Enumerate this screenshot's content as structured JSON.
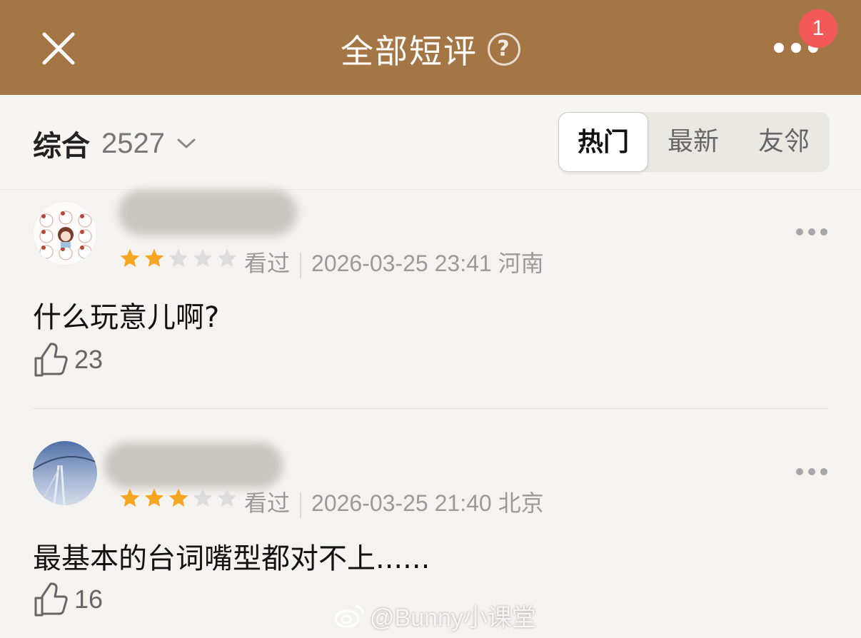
{
  "header": {
    "title": "全部短评",
    "help_icon": "question-circle-icon",
    "close_icon": "close-icon",
    "more_icon": "more-dots-icon",
    "badge_count": "1",
    "background_color": "#a57645"
  },
  "filter": {
    "sort_label": "综合",
    "count": "2527",
    "tabs": [
      {
        "label": "热门",
        "active": true
      },
      {
        "label": "最新",
        "active": false
      },
      {
        "label": "友邻",
        "active": false
      }
    ]
  },
  "comments": [
    {
      "rating": 2,
      "rating_max": 5,
      "status": "看过",
      "datetime": "2026-03-25 23:41",
      "location": "河南",
      "text": "什么玩意儿啊?",
      "likes": "23"
    },
    {
      "rating": 3,
      "rating_max": 5,
      "status": "看过",
      "datetime": "2026-03-25 21:40",
      "location": "北京",
      "text": "最基本的台词嘴型都对不上......",
      "likes": "16"
    }
  ],
  "watermark": "@Bunny小课堂",
  "colors": {
    "star_filled": "#f5a623",
    "star_empty": "#dcdcdc",
    "badge": "#f25a5a"
  }
}
